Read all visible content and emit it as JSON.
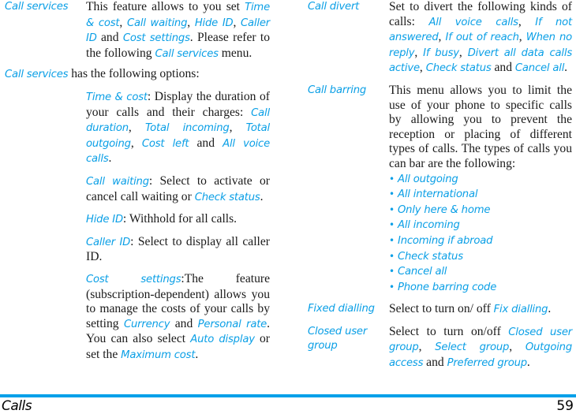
{
  "left": {
    "call_services": {
      "term": "Call services",
      "t1": "This feature allows to you set ",
      "h1": "Time & cost",
      "t2": ", ",
      "h2": "Call waiting",
      "t3": ", ",
      "h3": "Hide ID",
      "t4": ", ",
      "h4": "Caller ID",
      "t5": " and ",
      "h5": "Cost settings",
      "t6": ". Please refer to the following ",
      "h6": "Call services",
      "t7": " menu."
    },
    "intro": {
      "h": "Call services",
      "t": " has the following options:"
    },
    "time_cost": {
      "h1": "Time & cost",
      "t1": ": Display the duration of your calls and their charges: ",
      "h2": "Call duration",
      "t2": ", ",
      "h3": "Total incoming",
      "t3": ", ",
      "h4": "Total outgoing",
      "t4": ", ",
      "h5": "Cost left",
      "t5": " and ",
      "h6": "All voice calls",
      "t6": "."
    },
    "call_waiting": {
      "h1": "Call waiting",
      "t1": ": Select to activate or cancel call waiting or ",
      "h2": "Check status",
      "t2": "."
    },
    "hide_id": {
      "h1": "Hide ID",
      "t1": ": Withhold for all calls."
    },
    "caller_id": {
      "h1": "Caller ID",
      "t1": ": Select to display all caller ID."
    },
    "cost_settings": {
      "h1": "Cost settings",
      "t1": ":The feature (subscription-dependent) allows you to manage the costs of your calls by setting ",
      "h2": "Currency",
      "t2": " and ",
      "h3": "Personal rate",
      "t3": ". You can also select ",
      "h4": "Auto display",
      "t4": " or set the ",
      "h5": "Maximum cost",
      "t5": "."
    }
  },
  "right": {
    "call_divert": {
      "term": "Call divert",
      "t1": "Set to divert the following kinds of calls: ",
      "h1": "All voice calls",
      "t2": ", ",
      "h2": "If not answered",
      "t3": ", ",
      "h3": "If out of reach",
      "t4": ", ",
      "h4": "When no reply",
      "t5": ", ",
      "h5": "If busy",
      "t6": ", ",
      "h6": "Divert all data calls active",
      "t7": ", ",
      "h7": "Check status",
      "t8": " and ",
      "h8": "Cancel all",
      "t9": "."
    },
    "call_barring": {
      "term": "Call barring",
      "t1": "This menu allows you to limit the use of your phone to specific calls by allowing you to prevent the reception or placing of different types of calls. The types of calls you can bar are the following:",
      "items": [
        "All outgoing",
        "All international",
        "Only here & home",
        "All incoming",
        "Incoming if abroad",
        "Check status",
        "Cancel all",
        "Phone barring code"
      ]
    },
    "fixed_dialling": {
      "term": "Fixed dialling",
      "t1": "Select to turn on/ off ",
      "h1": "Fix dialling",
      "t2": "."
    },
    "closed_user_group": {
      "term": "Closed user group",
      "t1": "Select to turn on/off ",
      "h1": "Closed user group",
      "t2": ", ",
      "h2": "Select group",
      "t3": ", ",
      "h3": "Outgoing access",
      "t4": " and ",
      "h4": "Preferred group",
      "t5": "."
    }
  },
  "footer": {
    "section": "Calls",
    "page": "59"
  },
  "colors": {
    "accent": "#00a0e9",
    "text": "#1a1a1a"
  }
}
